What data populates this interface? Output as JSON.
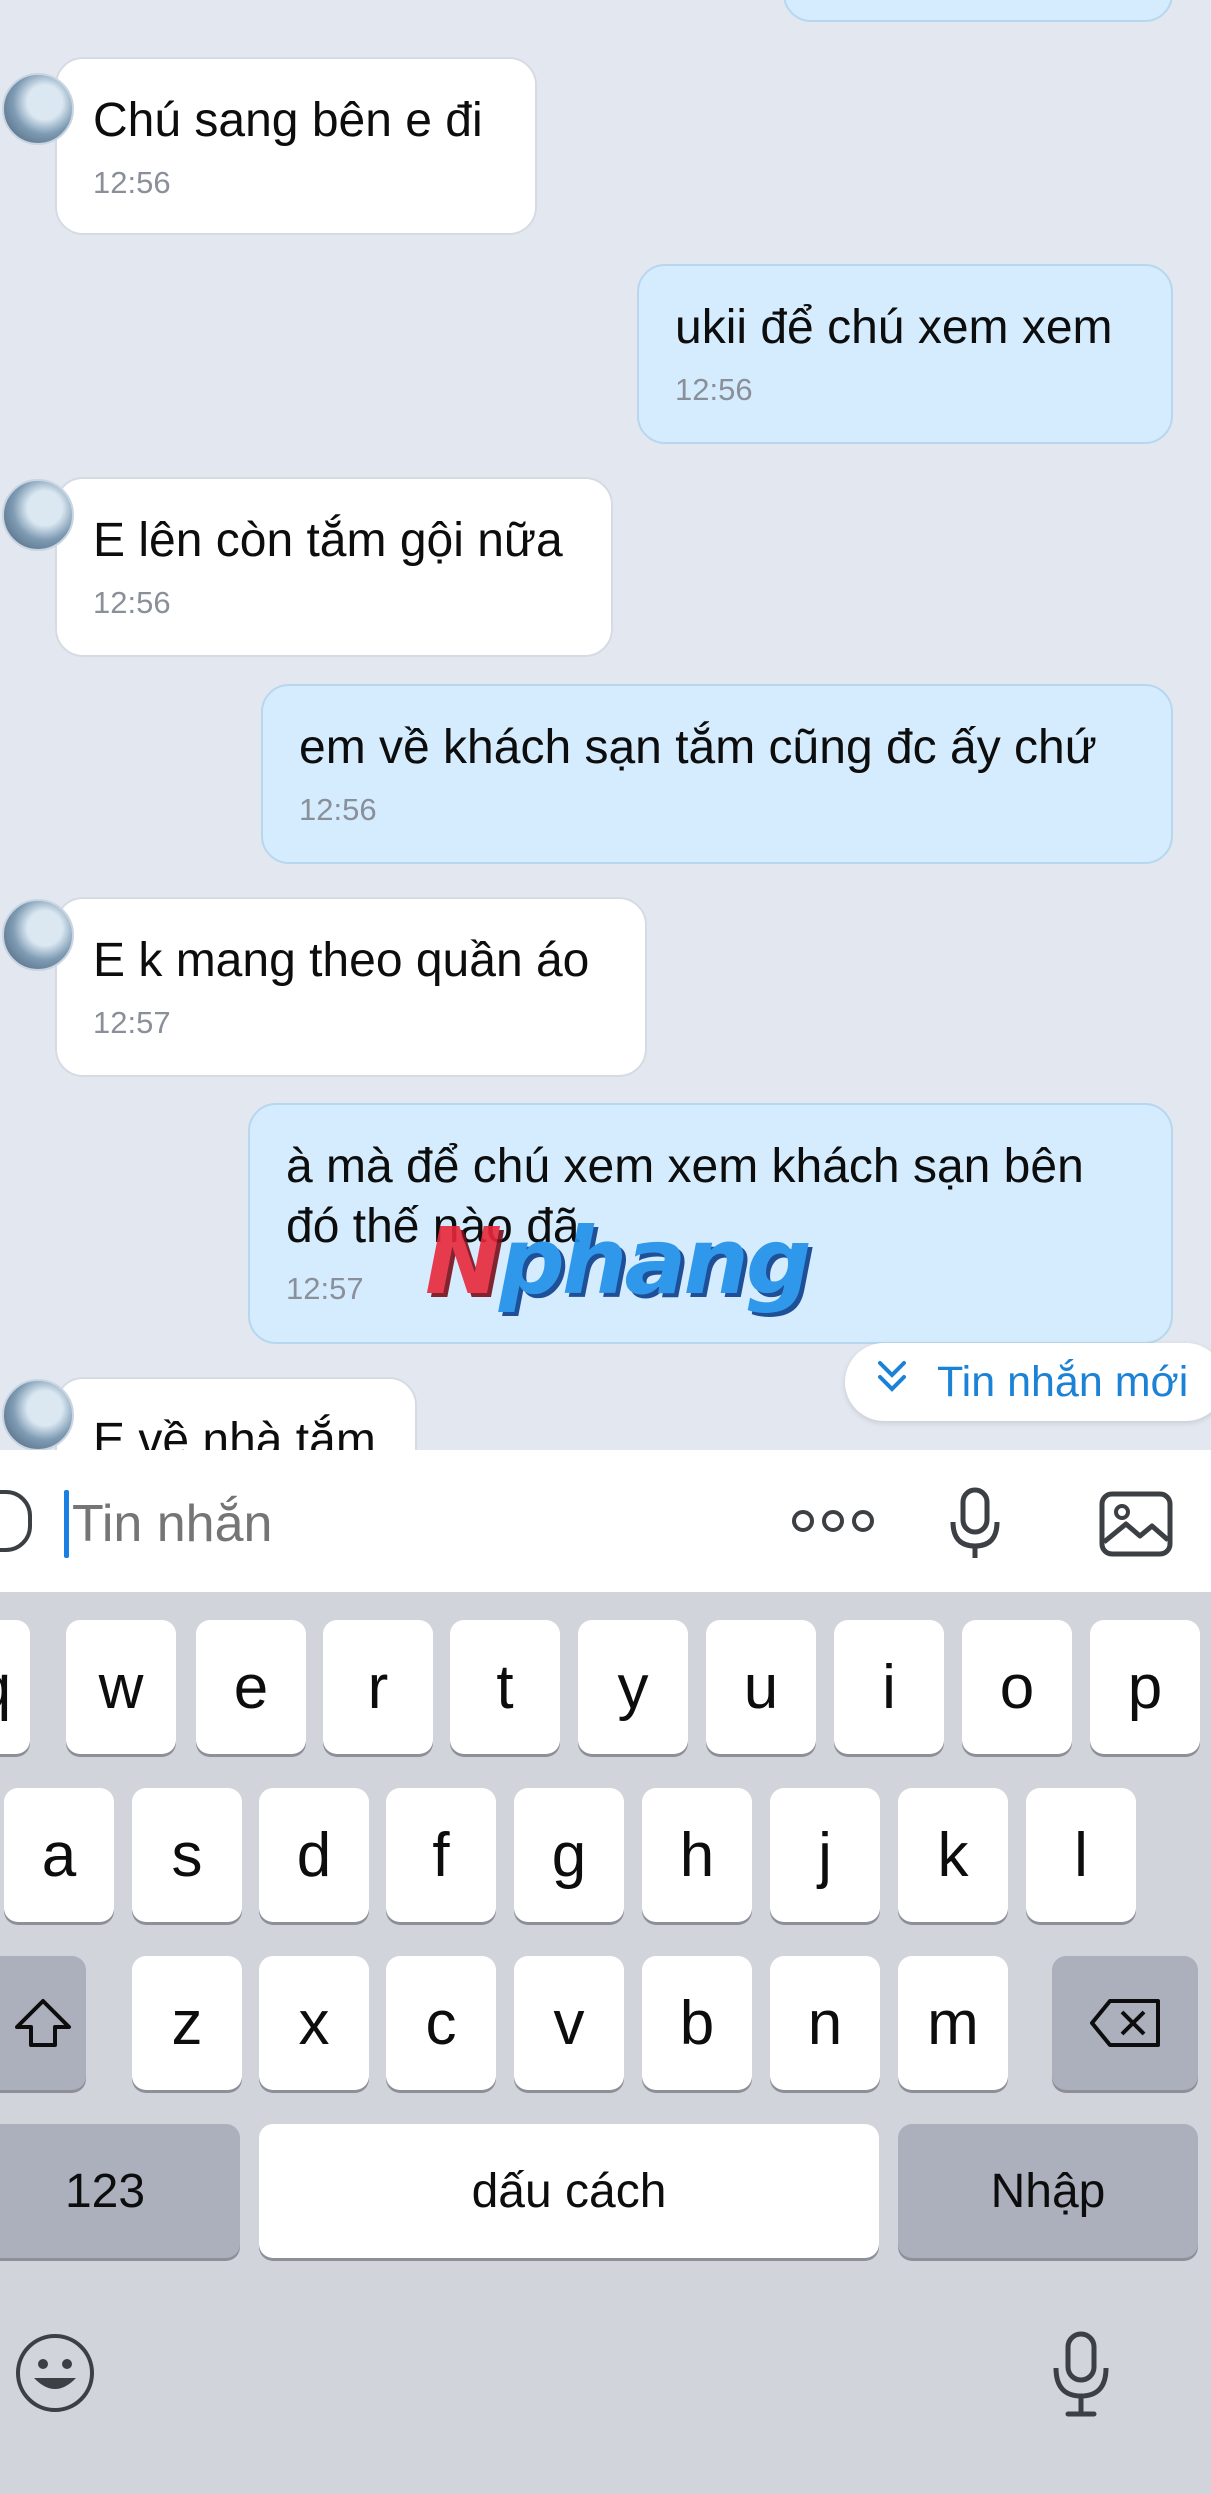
{
  "messages": [
    {
      "side": "in",
      "text": "Chú sang bên e đi",
      "time": "12:56"
    },
    {
      "side": "out",
      "text": "ukii để chú xem xem",
      "time": "12:56"
    },
    {
      "side": "in",
      "text": "E lên còn tắm gội nữa",
      "time": "12:56"
    },
    {
      "side": "out",
      "text": "em về khách sạn tắm cũng đc ấy chứ",
      "time": "12:56"
    },
    {
      "side": "in",
      "text": "E k mang theo quần áo",
      "time": "12:57"
    },
    {
      "side": "out",
      "text_line1": "à mà để chú xem xem khách sạn bên",
      "text_line2": "đó thế nào đã",
      "time": "12:57"
    },
    {
      "side": "in",
      "text": "E về nhà tắm"
    }
  ],
  "watermark": {
    "first": "N",
    "rest": "phang"
  },
  "new_messages_button": {
    "label": "Tin nhắn mới",
    "icon": "double-chevron-down-icon"
  },
  "input": {
    "placeholder": "Tin nhắn"
  },
  "keyboard": {
    "row1": [
      "q",
      "w",
      "e",
      "r",
      "t",
      "y",
      "u",
      "i",
      "o",
      "p"
    ],
    "row2": [
      "a",
      "s",
      "d",
      "f",
      "g",
      "h",
      "j",
      "k",
      "l"
    ],
    "row3": [
      "z",
      "x",
      "c",
      "v",
      "b",
      "n",
      "m"
    ],
    "numbers_key": "123",
    "space_key": "dấu cách",
    "return_key": "Nhập"
  },
  "colors": {
    "incoming_bubble": "#ffffff",
    "outgoing_bubble": "#d4ecfd",
    "accent": "#1b82d6",
    "chat_bg": "#e2e7f0"
  }
}
